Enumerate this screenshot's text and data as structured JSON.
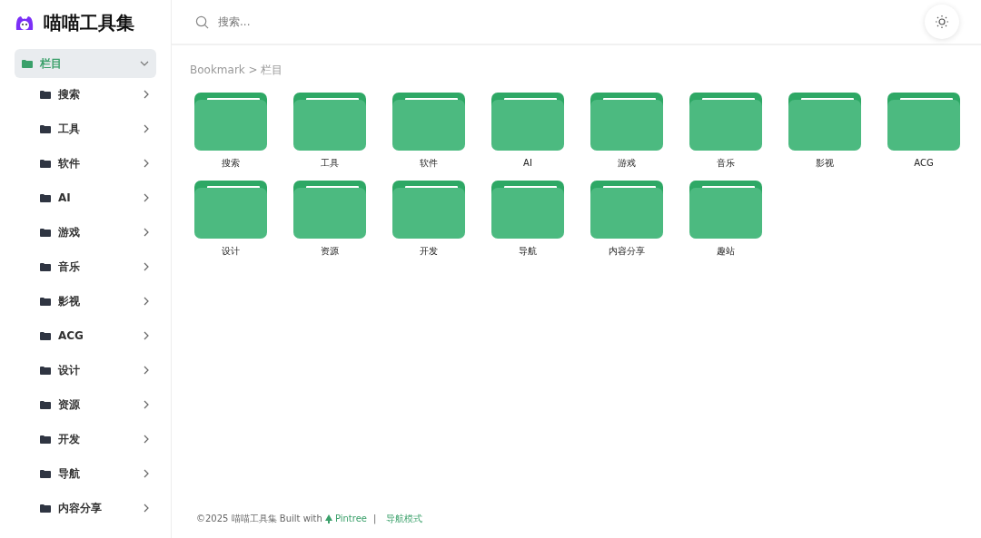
{
  "brand": {
    "title": "喵喵工具集"
  },
  "sidebar": {
    "items": [
      {
        "label": "栏目",
        "selected": true,
        "expanded": true,
        "children": [
          {
            "label": "搜索",
            "selected": false,
            "expanded": false
          },
          {
            "label": "工具",
            "selected": false,
            "expanded": false
          },
          {
            "label": "软件",
            "selected": false,
            "expanded": false
          },
          {
            "label": "AI",
            "selected": false,
            "expanded": false
          },
          {
            "label": "游戏",
            "selected": false,
            "expanded": false
          },
          {
            "label": "音乐",
            "selected": false,
            "expanded": false
          },
          {
            "label": "影视",
            "selected": false,
            "expanded": false
          },
          {
            "label": "ACG",
            "selected": false,
            "expanded": false
          },
          {
            "label": "设计",
            "selected": false,
            "expanded": false
          },
          {
            "label": "资源",
            "selected": false,
            "expanded": false
          },
          {
            "label": "开发",
            "selected": false,
            "expanded": false
          },
          {
            "label": "导航",
            "selected": false,
            "expanded": false
          },
          {
            "label": "内容分享",
            "selected": false,
            "expanded": false
          }
        ]
      }
    ]
  },
  "search": {
    "placeholder": "搜索..."
  },
  "breadcrumb": "Bookmark > 栏目",
  "folders": [
    "搜索",
    "工具",
    "软件",
    "AI",
    "游戏",
    "音乐",
    "影视",
    "ACG",
    "设计",
    "资源",
    "开发",
    "导航",
    "内容分享",
    "趣站"
  ],
  "footer": {
    "text": "©2025 喵喵工具集 Built with",
    "link": "Pintree",
    "separator": "|",
    "mode_link": "导航模式"
  }
}
